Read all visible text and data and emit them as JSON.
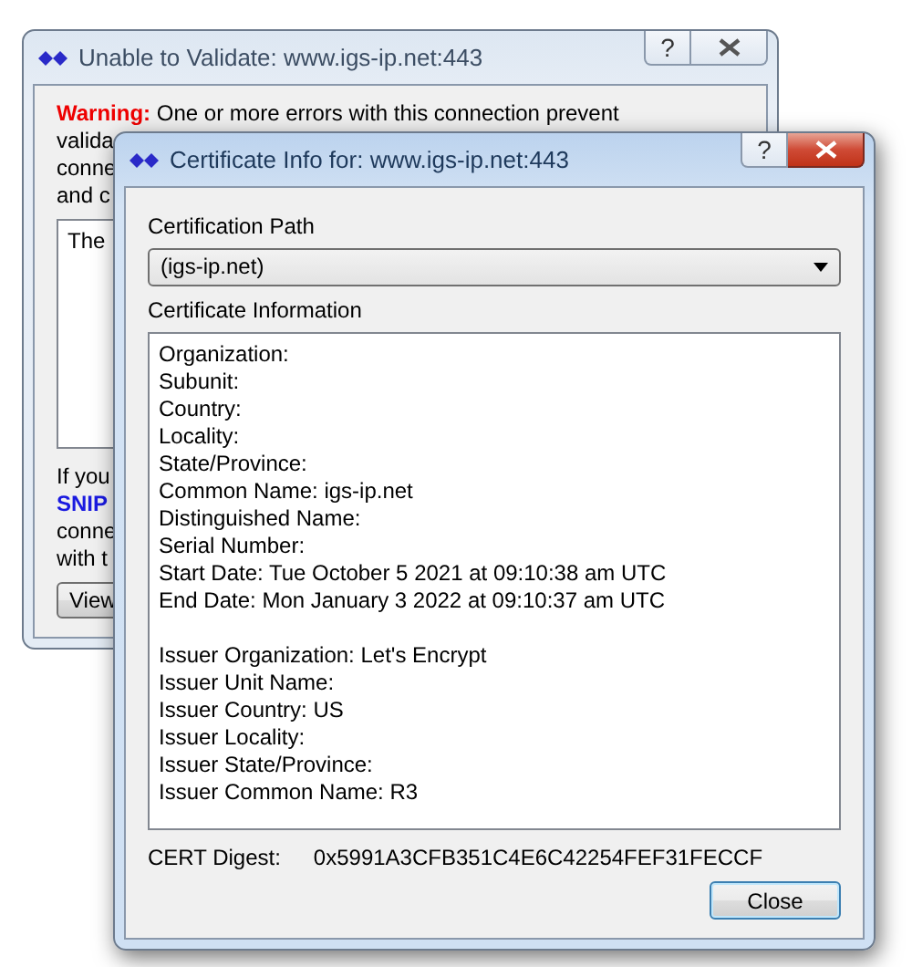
{
  "back_window": {
    "title": "Unable to Validate: www.igs-ip.net:443",
    "active": false,
    "help_button": "?",
    "warning_label": "Warning:",
    "message_lines": [
      "One or more errors with this connection prevent",
      "valida",
      "conne",
      "and c"
    ],
    "details_text": "The",
    "footer_lines": [
      {
        "text": "If you",
        "emphasis": false
      },
      {
        "text": "SNIP",
        "emphasis": true
      },
      {
        "text": "conne",
        "emphasis": false
      },
      {
        "text": "with t",
        "emphasis": false
      }
    ],
    "button": "View"
  },
  "front_window": {
    "title": "Certificate Info for: www.igs-ip.net:443",
    "active": true,
    "help_button": "?",
    "path_label": "Certification Path",
    "path_value": "(igs-ip.net)",
    "info_label": "Certificate Information",
    "subject_lines": [
      "Organization:",
      "Subunit:",
      "Country:",
      "Locality:",
      "State/Province:",
      "Common Name: igs-ip.net",
      "Distinguished Name:",
      "Serial Number:",
      "Start Date: Tue October 5 2021 at 09:10:38 am UTC",
      "End Date: Mon January 3 2022 at 09:10:37 am UTC"
    ],
    "issuer_lines": [
      "Issuer Organization: Let's Encrypt",
      "Issuer Unit Name:",
      "Issuer Country: US",
      "Issuer Locality:",
      "Issuer State/Province:",
      "Issuer Common Name: R3"
    ],
    "digest_label": "CERT Digest:",
    "digest_value": "0x5991A3CFB351C4E6C42254FEF31FECCF",
    "button": "Close"
  }
}
